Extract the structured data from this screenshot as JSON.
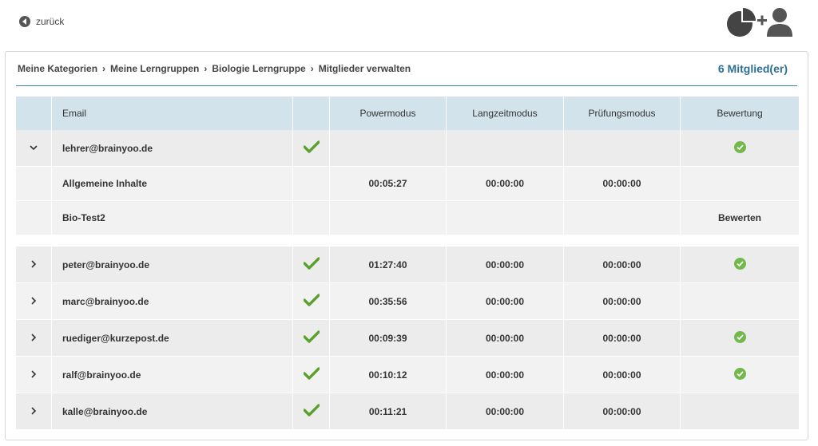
{
  "nav": {
    "back_label": "zurück"
  },
  "breadcrumb": [
    "Meine Kategorien",
    "Meine Lerngruppen",
    "Biologie Lerngruppe",
    "Mitglieder verwalten"
  ],
  "member_count": "6 Mitglied(er)",
  "columns": {
    "email": "Email",
    "power": "Powermodus",
    "long": "Langzeitmodus",
    "exam": "Prüfungsmodus",
    "rating": "Bewertung"
  },
  "expanded_member": {
    "email": "lehrer@brainyoo.de",
    "sub": [
      {
        "name": "Allgemeine Inhalte",
        "power": "00:05:27",
        "long": "00:00:00",
        "exam": "00:00:00",
        "rating": ""
      },
      {
        "name": "Bio-Test2",
        "power": "",
        "long": "",
        "exam": "",
        "rating": "Bewerten"
      }
    ]
  },
  "members": [
    {
      "email": "peter@brainyoo.de",
      "power": "01:27:40",
      "long": "00:00:00",
      "exam": "00:00:00"
    },
    {
      "email": "marc@brainyoo.de",
      "power": "00:35:56",
      "long": "00:00:00",
      "exam": "00:00:00"
    },
    {
      "email": "ruediger@kurzepost.de",
      "power": "00:09:39",
      "long": "00:00:00",
      "exam": "00:00:00"
    },
    {
      "email": "ralf@brainyoo.de",
      "power": "00:10:12",
      "long": "00:00:00",
      "exam": "00:00:00"
    },
    {
      "email": "kalle@brainyoo.de",
      "power": "00:11:21",
      "long": "00:00:00",
      "exam": "00:00:00"
    }
  ],
  "icons": {
    "back": "back-arrow-icon",
    "stats": "pie-chart-icon",
    "add_user": "add-user-icon",
    "check": "checkmark-icon",
    "rated": "check-circle-icon",
    "expand": "chevron-right-icon",
    "collapse": "chevron-down-icon"
  },
  "colors": {
    "accent": "#2d6f94",
    "header_bg": "#d2e3ec",
    "check_green": "#5aa02c",
    "row_bg": "#ececec"
  }
}
